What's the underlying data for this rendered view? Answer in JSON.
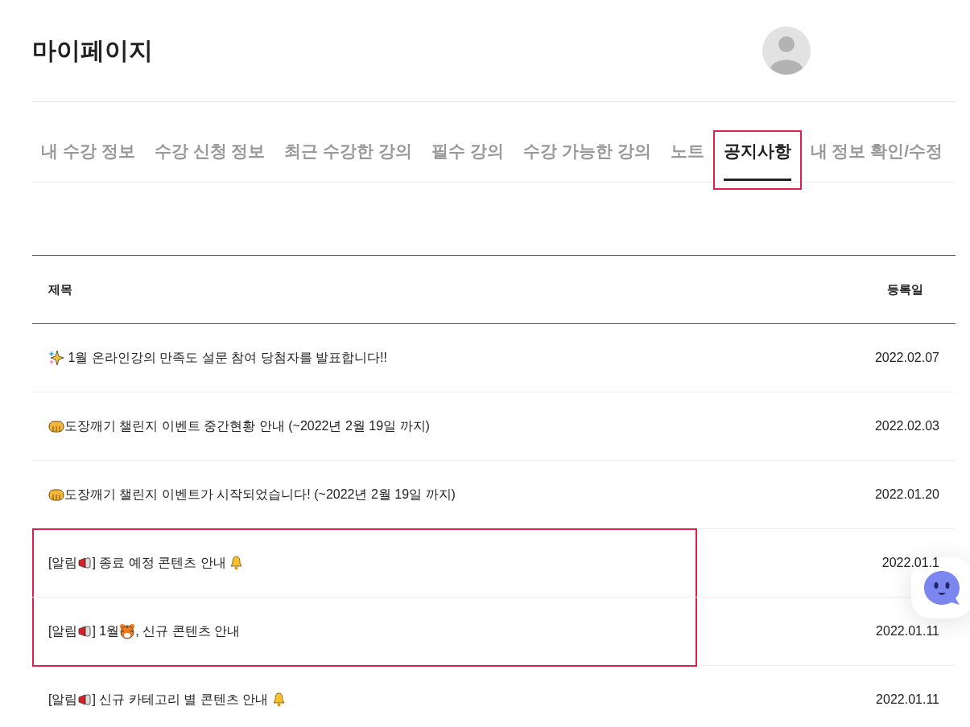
{
  "page": {
    "title": "마이페이지"
  },
  "tabs": [
    {
      "label": "내 수강 정보",
      "selected": false,
      "highlighted": false
    },
    {
      "label": "수강 신청 정보",
      "selected": false,
      "highlighted": false
    },
    {
      "label": "최근 수강한 강의",
      "selected": false,
      "highlighted": false
    },
    {
      "label": "필수 강의",
      "selected": false,
      "highlighted": false
    },
    {
      "label": "수강 가능한 강의",
      "selected": false,
      "highlighted": false
    },
    {
      "label": "노트",
      "selected": false,
      "highlighted": false
    },
    {
      "label": "공지사항",
      "selected": true,
      "highlighted": true
    },
    {
      "label": "내 정보 확인/수정",
      "selected": false,
      "highlighted": false
    }
  ],
  "table": {
    "columns": [
      "제목",
      "등록일"
    ],
    "rows": [
      {
        "highlighted": false,
        "date": "2022.02.07",
        "title": [
          {
            "kind": "sparkles"
          },
          {
            "kind": "text",
            "text": " 1월 온라인강의 만족도 설문 참여 당첨자를 발표합니다!!"
          }
        ]
      },
      {
        "highlighted": false,
        "date": "2022.02.03",
        "title": [
          {
            "kind": "fist"
          },
          {
            "kind": "text",
            "text": "도장깨기 챌린지 이벤트 중간현황 안내 (~2022년 2월 19일 까지)"
          }
        ]
      },
      {
        "highlighted": false,
        "date": "2022.01.20",
        "title": [
          {
            "kind": "fist"
          },
          {
            "kind": "text",
            "text": "도장깨기 챌린지 이벤트가 시작되었습니다! (~2022년 2월 19일 까지)"
          }
        ]
      },
      {
        "highlighted": true,
        "date": "2022.01.1",
        "title": [
          {
            "kind": "text",
            "text": "[알림"
          },
          {
            "kind": "megaphone"
          },
          {
            "kind": "text",
            "text": "] 종료 예정 콘텐츠 안내 "
          },
          {
            "kind": "bell"
          }
        ]
      },
      {
        "highlighted": true,
        "date": "2022.01.11",
        "title": [
          {
            "kind": "text",
            "text": "[알림"
          },
          {
            "kind": "megaphone"
          },
          {
            "kind": "text",
            "text": "] 1월"
          },
          {
            "kind": "tiger"
          },
          {
            "kind": "text",
            "text": ", 신규 콘텐츠 안내"
          }
        ]
      },
      {
        "highlighted": false,
        "date": "2022.01.11",
        "title": [
          {
            "kind": "text",
            "text": "[알림"
          },
          {
            "kind": "megaphone"
          },
          {
            "kind": "text",
            "text": "] 신규 카테고리 별 콘텐츠 안내 "
          },
          {
            "kind": "bell"
          }
        ]
      }
    ]
  },
  "chat_button": {
    "kind": "chatbot"
  }
}
